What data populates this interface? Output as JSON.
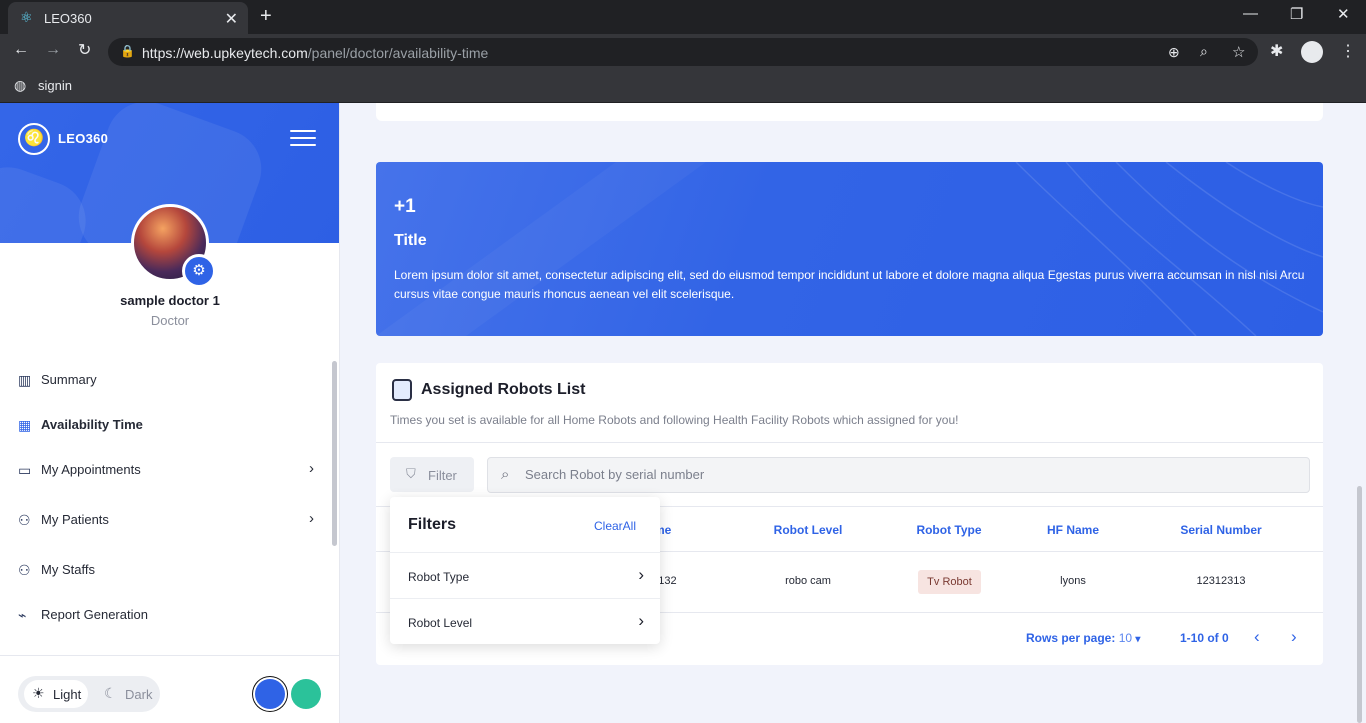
{
  "browser": {
    "tab_title": "LEO360",
    "tab_close": "✕",
    "new_tab": "+",
    "url_host": "https://web.upkeytech.com",
    "url_path": "/panel/doctor/availability-time",
    "bookmark": "signin",
    "window_controls": [
      "—",
      "❐",
      "✕"
    ]
  },
  "sidebar": {
    "brand": "LEO360",
    "profile": {
      "name": "sample doctor 1",
      "role": "Doctor"
    },
    "nav": [
      {
        "label": "Summary",
        "icon": "chart-icon",
        "has_submenu": false,
        "active": false
      },
      {
        "label": "Availability Time",
        "icon": "calendar-icon",
        "has_submenu": false,
        "active": true
      },
      {
        "label": "My Appointments",
        "icon": "monitor-icon",
        "has_submenu": true,
        "active": false
      },
      {
        "label": "My Patients",
        "icon": "users-icon",
        "has_submenu": true,
        "active": false
      },
      {
        "label": "My Staffs",
        "icon": "users-icon",
        "has_submenu": false,
        "active": false
      },
      {
        "label": "Report Generation",
        "icon": "report-icon",
        "has_submenu": false,
        "active": false
      }
    ],
    "theme": {
      "light": "Light",
      "dark": "Dark"
    },
    "colors": {
      "accent": "#2f63e6",
      "alt": "#2bc29a"
    }
  },
  "banner": {
    "count": "+1",
    "title": "Title",
    "description": "Lorem ipsum dolor sit amet, consectetur adipiscing elit, sed do eiusmod tempor incididunt ut labore et dolore magna aliqua Egestas purus viverra accumsan in nisl nisi Arcu cursus vitae congue mauris rhoncus aenean vel elit scelerisque."
  },
  "robots": {
    "title": "Assigned Robots List",
    "subtitle": "Times you set is available for all Home Robots and following Health Facility Robots which assigned for you!",
    "filter_label": "Filter",
    "search_placeholder": "Search Robot by serial number",
    "columns": [
      "me",
      "Robot Level",
      "Robot Type",
      "HF Name",
      "Serial Number"
    ],
    "rows": [
      {
        "name": "23132",
        "level": "robo cam",
        "type": "Tv Robot",
        "hf_name": "lyons",
        "serial": "12312313"
      }
    ],
    "pagination": {
      "rows_per_page_label": "Rows per page:",
      "rows_per_page": "10",
      "range": "1-10 of 0"
    }
  },
  "filters_popup": {
    "title": "Filters",
    "clear_all": "ClearAll",
    "items": [
      "Robot Type",
      "Robot Level"
    ]
  }
}
